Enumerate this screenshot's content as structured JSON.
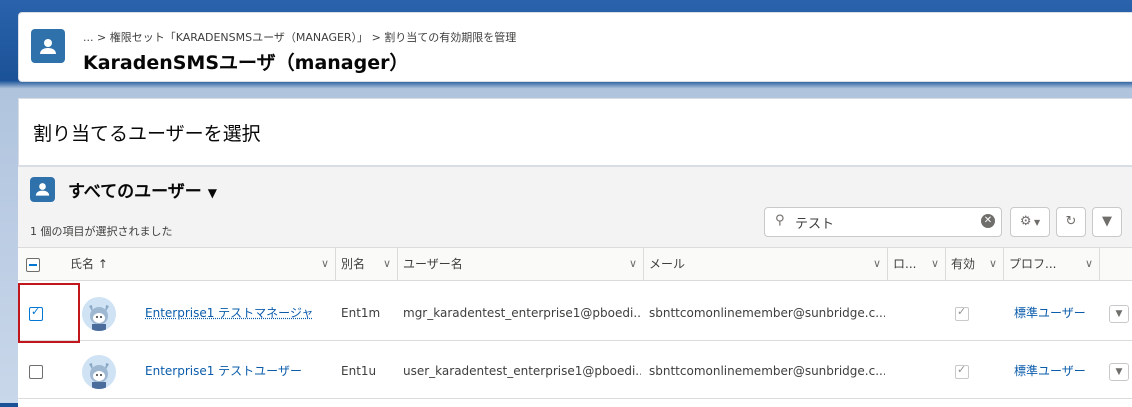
{
  "header": {
    "breadcrumb": {
      "ellipsis": "...",
      "item1": "権限セット「KARADENSMSユーザ（MANAGER）」",
      "item2": "割り当ての有効期限を管理"
    },
    "title": "KaradenSMSユーザ（manager）"
  },
  "section": {
    "title": "割り当てるユーザーを選択"
  },
  "listview": {
    "title": "すべてのユーザー",
    "selected_count": "1 個の項目が選択されました",
    "search": {
      "value": "テスト"
    }
  },
  "columns": {
    "name": "氏名 ↑",
    "alias": "別名",
    "username": "ユーザー名",
    "email": "メール",
    "locale": "ロ...",
    "active": "有効",
    "profile": "プロフ..."
  },
  "rows": [
    {
      "selected": true,
      "name": "Enterprise1 テストマネージャ",
      "alias": "Ent1m",
      "username": "mgr_karadentest_enterprise1@pboedi...",
      "email": "sbnttcomonlinemember@sunbridge.c...",
      "active": true,
      "profile": "標準ユーザー"
    },
    {
      "selected": false,
      "name": "Enterprise1 テストユーザー",
      "alias": "Ent1u",
      "username": "user_karadentest_enterprise1@pboedi...",
      "email": "sbnttcomonlinemember@sunbridge.c...",
      "active": true,
      "profile": "標準ユーザー"
    }
  ],
  "icons": {
    "header": "user-icon",
    "listview": "user-icon",
    "search": "search-icon",
    "clear": "clear-icon",
    "settings": "gear-icon",
    "refresh": "refresh-icon",
    "filter": "filter-icon"
  },
  "colors": {
    "accent": "#2e71ab",
    "link": "#0b5cab",
    "highlight": "#c0161c"
  }
}
